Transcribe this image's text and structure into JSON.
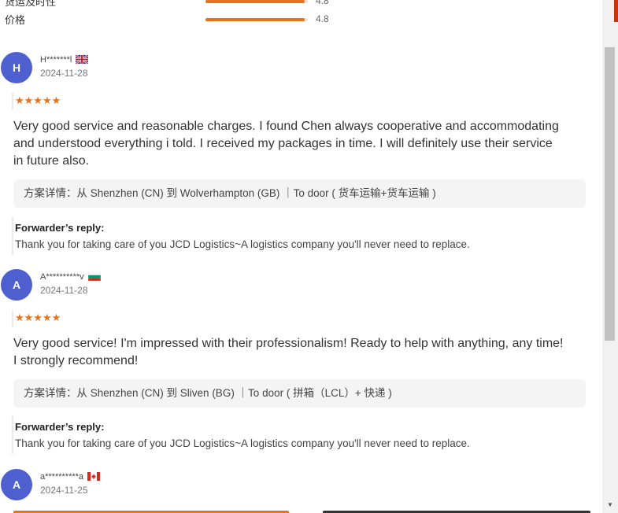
{
  "ratings": [
    {
      "label": "货运及时性",
      "score": "4.8",
      "value": 0.97
    },
    {
      "label": "价格",
      "score": "4.8",
      "value": 0.97
    }
  ],
  "reviews": [
    {
      "initial": "H",
      "name": "H*******l",
      "country_flag": "uk-flag-icon",
      "date": "2024-11-28",
      "stars": "★★★★★",
      "text": "Very good service and reasonable charges. I found Chen always cooperative and accommodating and understood everything i told. I received my packages in time. I will definitely use their service in future also.",
      "route": "方案详情：从 Shenzhen (CN) 到 Wolverhampton (GB) ｜To door ( 货车运输+货车运输 )",
      "reply_title": "Forwarder’s reply:",
      "reply_text": "Thank you for taking care of you JCD Logistics~A logistics company you'll never need to replace."
    },
    {
      "initial": "A",
      "name": "A**********v",
      "country_flag": "bulgaria-flag-icon",
      "date": "2024-11-28",
      "stars": "★★★★★",
      "text": "Very good service! I'm impressed with their professionalism! Ready to help with anything, any time! I strongly recommend!",
      "route": "方案详情：从 Shenzhen (CN) 到 Sliven (BG) ｜To door ( 拼箱（LCL）+ 快递 )",
      "reply_title": "Forwarder’s reply:",
      "reply_text": "Thank you for taking care of you JCD Logistics~A logistics company you'll never need to replace."
    },
    {
      "initial": "A",
      "name": "a**********a",
      "country_flag": "canada-flag-icon",
      "date": "2024-11-25"
    }
  ],
  "colors": {
    "accent": "#e8721c",
    "avatar": "#4e5fd0",
    "route_bg": "#f4f4f4"
  },
  "scrollbar": {
    "arrow_down": "▼"
  }
}
